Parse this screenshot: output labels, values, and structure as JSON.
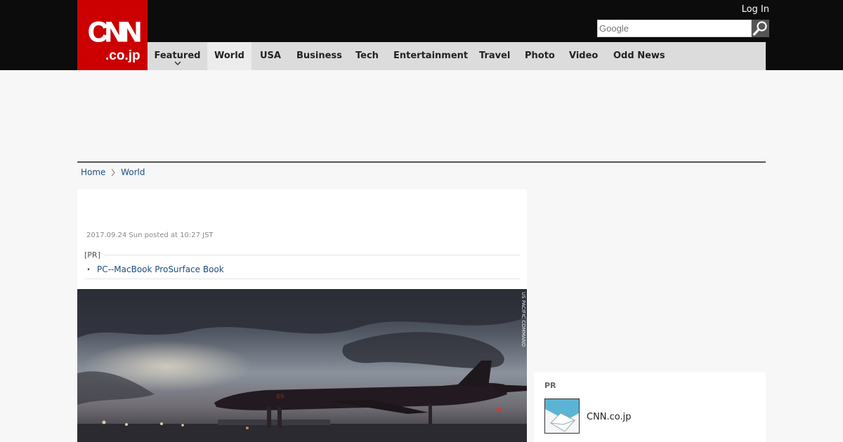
{
  "header": {
    "logo_main": "CNN",
    "logo_sub": ".co.jp",
    "login_label": "Log In",
    "search_placeholder": "Google"
  },
  "nav": {
    "items": [
      {
        "label": "Featured"
      },
      {
        "label": "World"
      },
      {
        "label": "USA"
      },
      {
        "label": "Business"
      },
      {
        "label": "Tech"
      },
      {
        "label": "Entertainment"
      },
      {
        "label": "Travel"
      },
      {
        "label": "Photo"
      },
      {
        "label": "Video"
      },
      {
        "label": "Odd News"
      }
    ],
    "active": "World"
  },
  "breadcrumb": {
    "home": "Home",
    "section": "World"
  },
  "article": {
    "date": "2017.09.24 Sun posted at 10:27 JST",
    "pr_tag": "[PR]",
    "pr_bullet": "・",
    "pr_link": "PC--MacBook ProSurface Book",
    "photo_credit": "US PACIFIC COMMAND"
  },
  "sidebar": {
    "pr_label": "PR",
    "pr_item_name": "CNN.co.jp"
  },
  "colors": {
    "brand_red": "#cc0000",
    "topbar": "#0c0c0c",
    "nav_bg": "#dcdcdc",
    "link": "#1a4d80"
  }
}
